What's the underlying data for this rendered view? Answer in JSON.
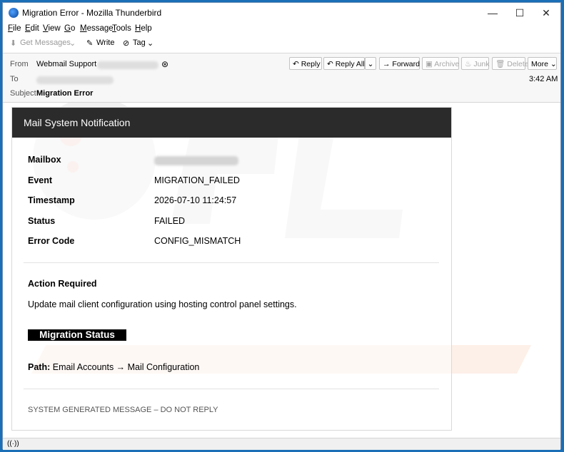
{
  "window": {
    "title": "Migration Error - Mozilla Thunderbird",
    "minimize": "—",
    "maximize": "☐",
    "close": "✕"
  },
  "menu": [
    "File",
    "Edit",
    "View",
    "Go",
    "Message",
    "Tools",
    "Help"
  ],
  "toolbar": {
    "get_messages": "Get Messages",
    "write": "Write",
    "tag": "Tag"
  },
  "header": {
    "from_label": "From",
    "from_name": "Webmail Support",
    "to_label": "To",
    "subject_label": "Subject",
    "subject": "Migration Error",
    "time": "3:42 AM",
    "buttons": {
      "reply": "Reply",
      "reply_all": "Reply All",
      "forward": "Forward",
      "archive": "Archive",
      "junk": "Junk",
      "delete": "Delete",
      "more": "More"
    }
  },
  "email": {
    "banner": "Mail System Notification",
    "fields": [
      {
        "label": "Mailbox",
        "value": ""
      },
      {
        "label": "Event",
        "value": "MIGRATION_FAILED"
      },
      {
        "label": "Timestamp",
        "value": "2026-07-10 11:24:57"
      },
      {
        "label": "Status",
        "value": "FAILED"
      },
      {
        "label": "Error Code",
        "value": "CONFIG_MISMATCH"
      }
    ],
    "action_title": "Action Required",
    "action_text": "Update mail client configuration using hosting control panel settings.",
    "status_button": "Migration Status",
    "path_label": "Path:",
    "path_value": "Email Accounts → Mail Configuration",
    "footer": "SYSTEM GENERATED MESSAGE – DO NOT REPLY"
  },
  "statusbar": {
    "icon": "wifi-icon",
    "symbol": "((·))"
  },
  "colors": {
    "banner_bg": "#2b2b2b",
    "desktop": "#1a6fb6"
  }
}
